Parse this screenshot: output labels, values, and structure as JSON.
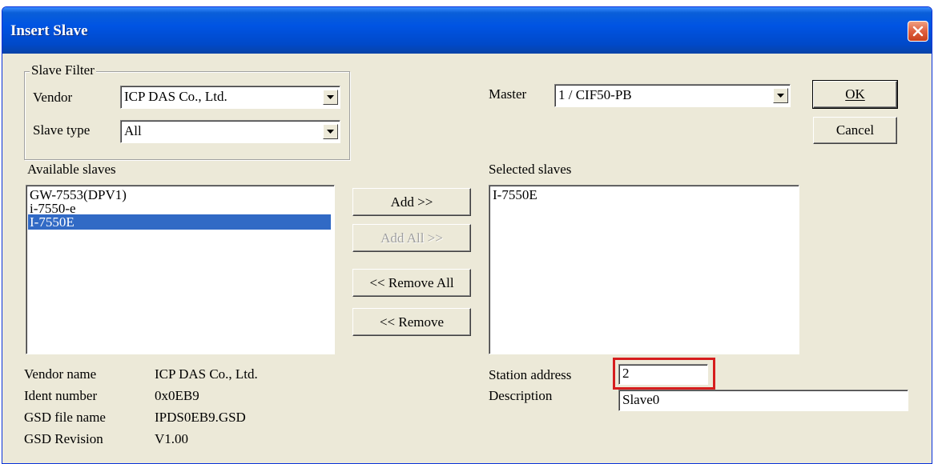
{
  "window": {
    "title": "Insert Slave"
  },
  "slave_filter": {
    "legend": "Slave Filter",
    "vendor_label": "Vendor",
    "vendor_value": "ICP DAS Co., Ltd.",
    "slave_type_label": "Slave type",
    "slave_type_value": "All"
  },
  "master": {
    "label": "Master",
    "value": "1 / CIF50-PB"
  },
  "buttons": {
    "ok": "OK",
    "cancel": "Cancel",
    "add": "Add >>",
    "add_all": "Add All >>",
    "remove_all": "<< Remove All",
    "remove": "<< Remove"
  },
  "available_slaves": {
    "label": "Available slaves",
    "items": [
      "GW-7553(DPV1)",
      "i-7550-e",
      "I-7550E"
    ],
    "selected_index": 2
  },
  "selected_slaves": {
    "label": "Selected slaves",
    "items": [
      "I-7550E"
    ]
  },
  "info": {
    "vendor_name_label": "Vendor name",
    "vendor_name_value": "ICP DAS Co., Ltd.",
    "ident_number_label": "Ident number",
    "ident_number_value": "0x0EB9",
    "gsd_file_label": "GSD file name",
    "gsd_file_value": "IPDS0EB9.GSD",
    "gsd_revision_label": "GSD Revision",
    "gsd_revision_value": "V1.00"
  },
  "station": {
    "address_label": "Station address",
    "address_value": "2",
    "description_label": "Description",
    "description_value": "Slave0"
  },
  "colors": {
    "titlebar": "#0054e3",
    "dialog_bg": "#ece9d8",
    "selection": "#316ac5",
    "highlight": "#d61d1d"
  }
}
